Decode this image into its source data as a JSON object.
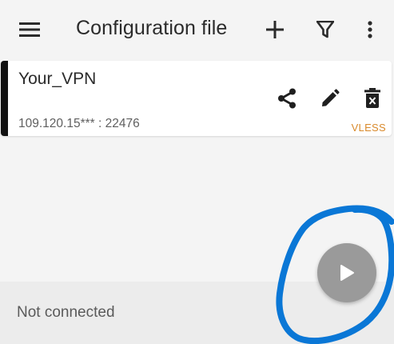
{
  "topbar": {
    "menu_icon": "hamburger-menu-icon",
    "title": "Configuration file",
    "add_icon": "plus-icon",
    "filter_icon": "filter-funnel-icon",
    "more_icon": "more-vertical-icon"
  },
  "servers": [
    {
      "name": "Your_VPN",
      "address": "109.120.15*** : 22476",
      "type": "VLESS",
      "selected": true,
      "actions": [
        "share-icon",
        "edit-pencil-icon",
        "delete-icon"
      ]
    }
  ],
  "status": {
    "text": "Not connected"
  },
  "fab": {
    "icon": "play-icon"
  },
  "colors": {
    "background": "#f4f4f4",
    "card": "#ffffff",
    "selected_accent": "#111111",
    "type_label": "#d98a2c",
    "fab": "#9a9a9a",
    "annotation": "#0a77d6"
  }
}
